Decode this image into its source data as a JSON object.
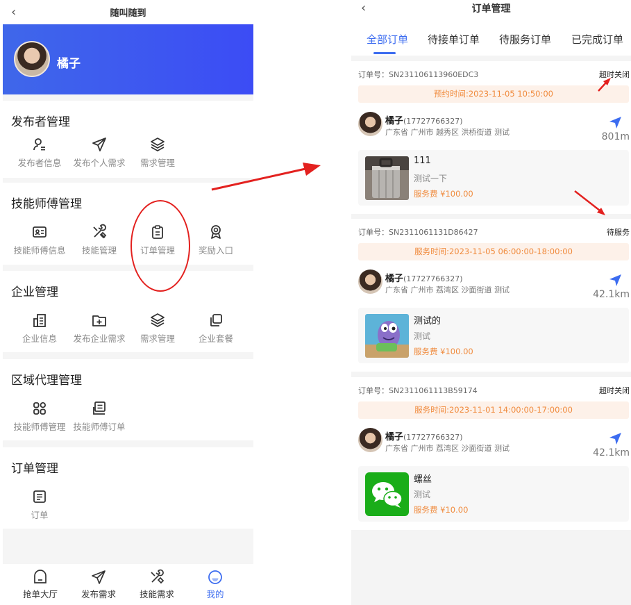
{
  "left_screen": {
    "navbar": {
      "title": "随叫随到",
      "back_icon": "chevron-left-icon"
    },
    "profile": {
      "name": "橘子"
    },
    "sections": [
      {
        "title": "发布者管理",
        "items": [
          {
            "label": "发布者信息",
            "icon": "user-info-icon"
          },
          {
            "label": "发布个人需求",
            "icon": "send-icon"
          },
          {
            "label": "需求管理",
            "icon": "layers-icon"
          }
        ]
      },
      {
        "title": "技能师傅管理",
        "items": [
          {
            "label": "技能师傅信息",
            "icon": "id-card-icon"
          },
          {
            "label": "技能管理",
            "icon": "tools-icon"
          },
          {
            "label": "订单管理",
            "icon": "clipboard-icon"
          },
          {
            "label": "奖励入口",
            "icon": "award-icon"
          }
        ]
      },
      {
        "title": "企业管理",
        "items": [
          {
            "label": "企业信息",
            "icon": "building-icon"
          },
          {
            "label": "发布企业需求",
            "icon": "folder-add-icon"
          },
          {
            "label": "需求管理",
            "icon": "layers-icon"
          },
          {
            "label": "企业套餐",
            "icon": "copy-icon"
          }
        ]
      },
      {
        "title": "区域代理管理",
        "items": [
          {
            "label": "技能师傅管理",
            "icon": "grid-icon"
          },
          {
            "label": "技能师傅订单",
            "icon": "order-list-icon"
          }
        ]
      },
      {
        "title": "订单管理",
        "items": [
          {
            "label": "订单",
            "icon": "document-icon"
          }
        ]
      }
    ],
    "tabbar": [
      {
        "label": "抢单大厅",
        "icon": "home-icon",
        "active": false
      },
      {
        "label": "发布需求",
        "icon": "send-icon",
        "active": false
      },
      {
        "label": "技能需求",
        "icon": "tools-icon",
        "active": false
      },
      {
        "label": "我的",
        "icon": "smile-icon",
        "active": true
      }
    ]
  },
  "right_screen": {
    "navbar": {
      "title": "订单管理",
      "back_icon": "chevron-left-icon"
    },
    "tabs": [
      "全部订单",
      "待接单订单",
      "待服务订单",
      "已完成订单"
    ],
    "active_tab": "全部订单",
    "orders": [
      {
        "order_no": "订单号：SN231106113960EDC3",
        "status": "超时关闭",
        "time": "预约时间:2023-11-05 10:50:00",
        "user_name": "橘子",
        "phone": "(17727766327)",
        "address": "广东省 广州市 越秀区 洪桥街道 测试",
        "distance": "801m",
        "product_name": "111",
        "product_desc": "测试一下",
        "fee": "服务费 ¥100.00",
        "thumb": "luggage-photo"
      },
      {
        "order_no": "订单号：SN2311061131D86427",
        "status": "待服务",
        "time": "服务时间:2023-11-05 06:00:00-18:00:00",
        "user_name": "橘子",
        "phone": "(17727766327)",
        "address": "广东省 广州市 荔湾区 沙面街道 测试",
        "distance": "42.1km",
        "product_name": "测试的",
        "product_desc": "测试",
        "fee": "服务费 ¥100.00",
        "thumb": "cartoon-fish-image"
      },
      {
        "order_no": "订单号：SN2311061113B59174",
        "status": "超时关闭",
        "time": "服务时间:2023-11-01 14:00:00-17:00:00",
        "user_name": "橘子",
        "phone": "(17727766327)",
        "address": "广东省 广州市 荔湾区 沙面街道 测试",
        "distance": "42.1km",
        "product_name": "螺丝",
        "product_desc": "测试",
        "fee": "服务费 ¥10.00",
        "thumb": "wechat-logo"
      }
    ]
  },
  "colors": {
    "accent": "#3c6cf0",
    "fee": "#f08a3c",
    "annotation_red": "#e3211f",
    "profile_bg": "#3c4cf5"
  }
}
